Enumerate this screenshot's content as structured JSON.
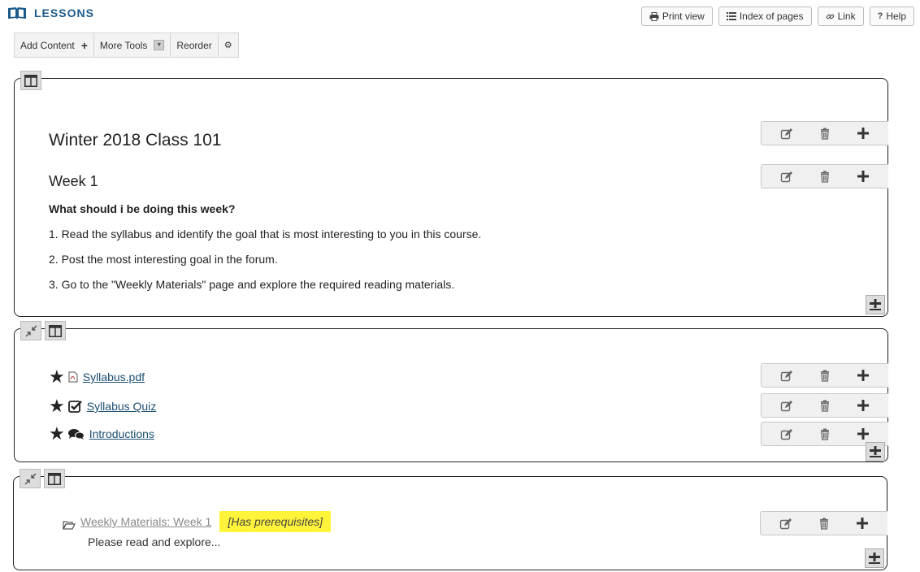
{
  "header": {
    "title": "LESSONS",
    "icon": "book-icon"
  },
  "top_buttons": [
    {
      "label": "Print view",
      "icon": "print-icon"
    },
    {
      "label": "Index of pages",
      "icon": "list-icon"
    },
    {
      "label": "Link",
      "icon": "link-icon"
    },
    {
      "label": "Help",
      "icon": "question-icon"
    }
  ],
  "toolbar": {
    "add_content": "Add Content",
    "more_tools": "More Tools",
    "reorder": "Reorder"
  },
  "section1": {
    "title": "Winter 2018 Class 101",
    "week": "Week 1",
    "question": "What should i be doing this week?",
    "lines": [
      "1. Read the syllabus and identify the goal that is most interesting to you in this course.",
      "2. Post the most interesting goal in the forum.",
      "3. Go to the \"Weekly Materials\" page and explore the required reading materials."
    ]
  },
  "section2": {
    "items": [
      {
        "label": "Syllabus.pdf",
        "icon": "pdf-icon",
        "required": true
      },
      {
        "label": "Syllabus Quiz",
        "icon": "checkbox-icon",
        "required": true
      },
      {
        "label": "Introductions",
        "icon": "forum-icon",
        "required": true
      }
    ]
  },
  "section3": {
    "link": "Weekly Materials: Week 1",
    "prereq": "[Has prerequisites]",
    "description": "Please read and explore...",
    "icon": "folder-open-icon",
    "prereq_color": "#fff43a"
  },
  "colors": {
    "accent": "#1b5a8c",
    "link": "#1b4f72"
  }
}
